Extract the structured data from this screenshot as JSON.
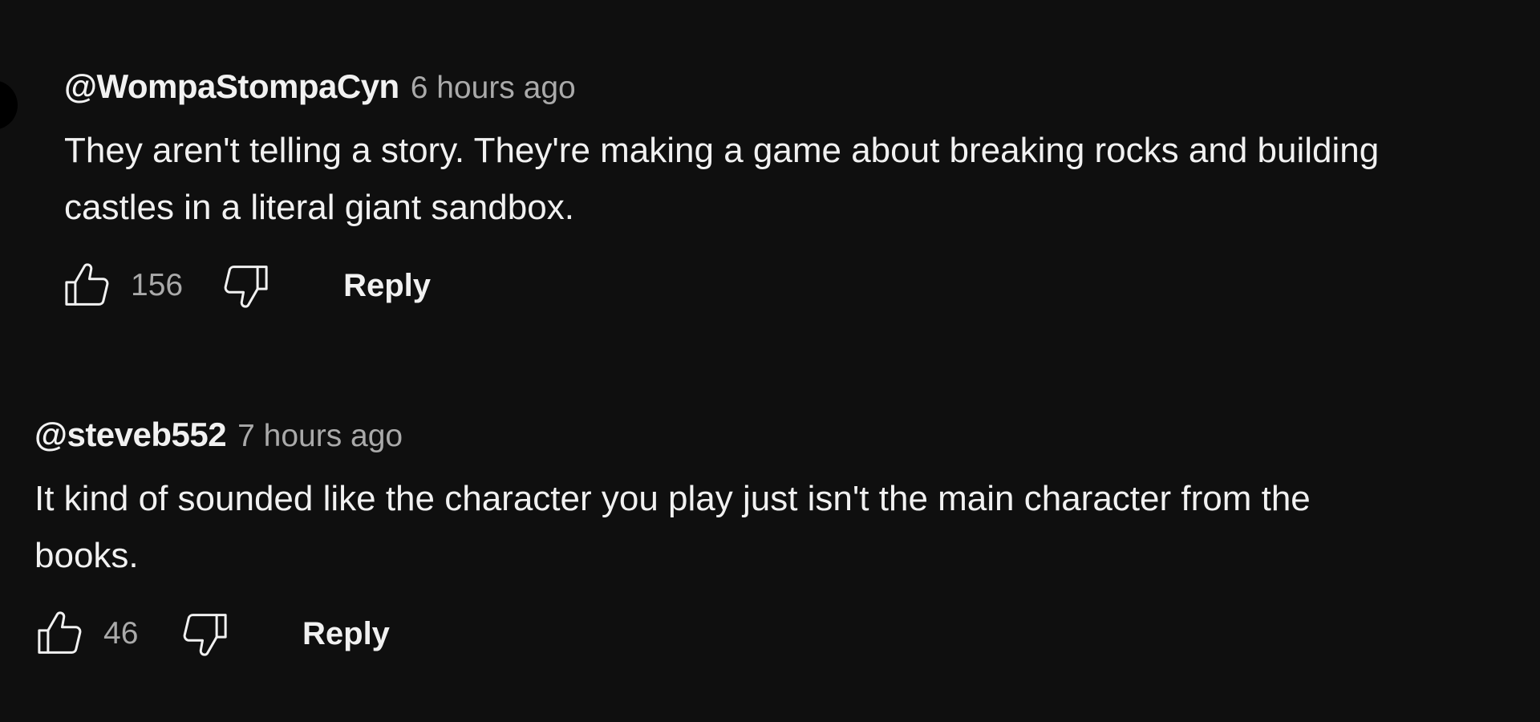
{
  "colors": {
    "background": "#0f0f0f",
    "primary_text": "#f1f1f1",
    "secondary_text": "#aaaaaa"
  },
  "icons": {
    "like": "thumbs-up-icon",
    "dislike": "thumbs-down-icon"
  },
  "comments": [
    {
      "author": "@WompaStompaCyn",
      "timestamp": "6 hours ago",
      "text": "They aren't telling a story. They're making a game about breaking rocks and building\ncastles in a literal giant sandbox.",
      "likes": "156",
      "reply_label": "Reply"
    },
    {
      "author": "@steveb552",
      "timestamp": "7 hours ago",
      "text": "It kind of sounded like the character you play just isn't the main character from the\nbooks.",
      "likes": "46",
      "reply_label": "Reply"
    }
  ]
}
